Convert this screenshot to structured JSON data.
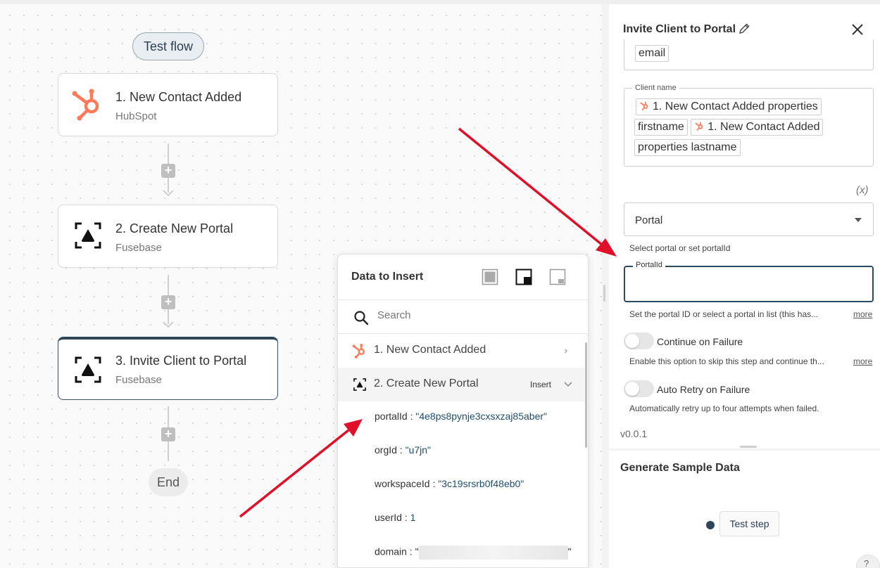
{
  "canvas": {
    "test_flow_label": "Test flow",
    "steps": [
      {
        "title": "1. New Contact Added",
        "subtitle": "HubSpot",
        "icon": "hubspot-icon"
      },
      {
        "title": "2. Create New Portal",
        "subtitle": "Fusebase",
        "icon": "fusebase-icon"
      },
      {
        "title": "3. Invite Client to Portal",
        "subtitle": "Fusebase",
        "icon": "fusebase-icon"
      }
    ],
    "add_step_label": "+",
    "end_label": "End"
  },
  "data_popup": {
    "title": "Data to Insert",
    "search_placeholder": "Search",
    "sources": [
      {
        "label": "1. New Contact Added",
        "icon": "hubspot-icon",
        "chevron": "›"
      },
      {
        "label": "2. Create New Portal",
        "icon": "fusebase-icon",
        "insert_label": "Insert",
        "chevron": "⌄"
      }
    ],
    "fields": [
      {
        "key": "portalId",
        "sep": " : ",
        "value": "\"4e8ps8pynje3cxsxzaj85aber\""
      },
      {
        "key": "orgId",
        "sep": " : ",
        "value": "\"u7jn\""
      },
      {
        "key": "workspaceId",
        "sep": " : ",
        "value": "\"3c19srsrb0f48eb0\""
      },
      {
        "key": "userId",
        "sep": " : ",
        "value": "1"
      },
      {
        "key": "domain",
        "sep": " : ",
        "value_open": "\"",
        "value_close": "\""
      }
    ]
  },
  "panel": {
    "title": "Invite Client to Portal",
    "email_chip": "email",
    "client_name_label": "Client name",
    "client_name_chips": {
      "chip1": "1. New Contact Added properties",
      "chip2": "firstname",
      "chip3": "1. New Contact Added",
      "chip4": "properties lastname"
    },
    "variable_toggle": "(x)",
    "portal_select_value": "Portal",
    "portal_select_help": "Select portal or set portalId",
    "portal_id_label": "PortalId",
    "portal_id_value": "",
    "portal_id_help": "Set the portal ID or select a portal in list (this has...",
    "more_label": "more",
    "continue_on_failure_label": "Continue on Failure",
    "continue_on_failure_help": "Enable this option to skip this step and continue th...",
    "auto_retry_label": "Auto Retry on Failure",
    "auto_retry_help": "Automatically retry up to four attempts when failed.",
    "version": "v0.0.1"
  },
  "sample": {
    "title": "Generate Sample Data",
    "test_step_label": "Test step",
    "help_label": "?"
  },
  "colors": {
    "accent": "#2f4658",
    "hubspot": "#ff7a59",
    "annotation_arrow": "#e0102b"
  }
}
